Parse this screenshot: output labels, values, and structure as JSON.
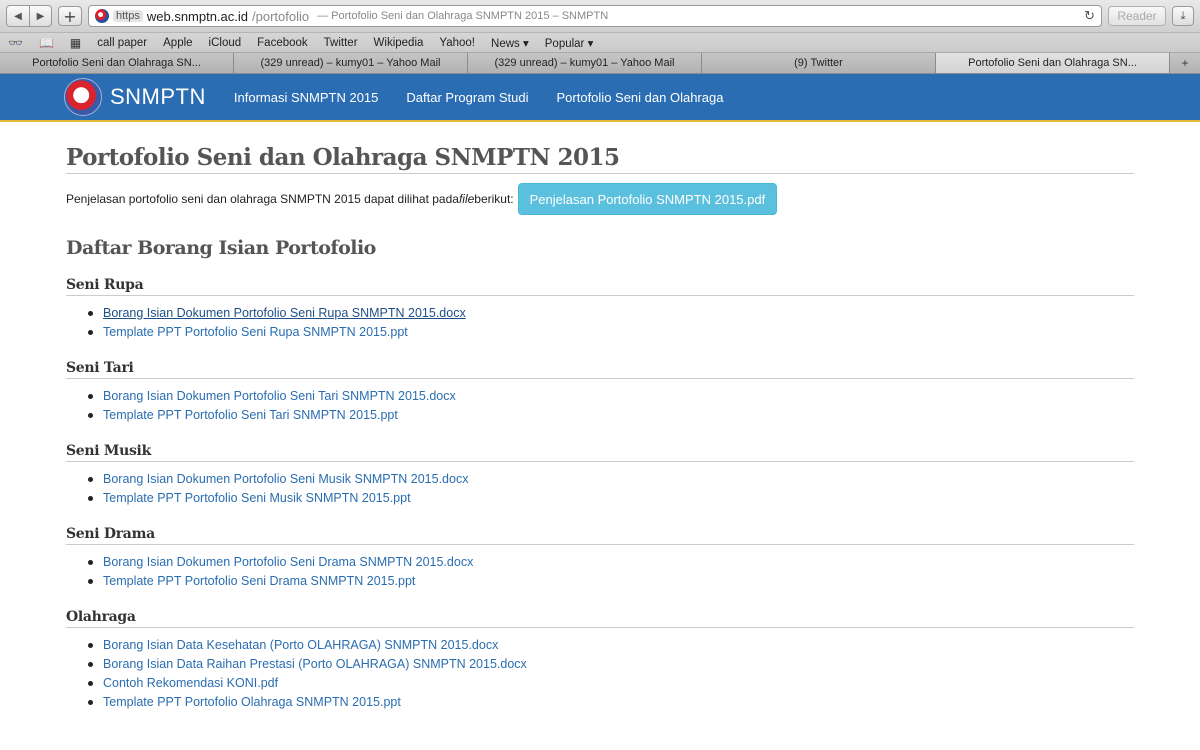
{
  "browser": {
    "address": {
      "https_label": "https",
      "host": "web.snmptn.ac.id",
      "path": "/portofolio",
      "page_title": "— Portofolio Seni dan Olahraga SNMPTN 2015 – SNMPTN",
      "reader_label": "Reader"
    },
    "bookmarks": [
      "call paper",
      "Apple",
      "iCloud",
      "Facebook",
      "Twitter",
      "Wikipedia",
      "Yahoo!",
      "News ▾",
      "Popular ▾"
    ],
    "tabs": [
      {
        "label": "Portofolio Seni dan Olahraga SN...",
        "active": false
      },
      {
        "label": "(329 unread) – kumy01 – Yahoo Mail",
        "active": false
      },
      {
        "label": "(329 unread) – kumy01 – Yahoo Mail",
        "active": false
      },
      {
        "label": "(9) Twitter",
        "active": false
      },
      {
        "label": "Portofolio Seni dan Olahraga SN...",
        "active": true
      }
    ]
  },
  "site": {
    "logo_text": "SNMPTN",
    "nav": [
      "Informasi SNMPTN 2015",
      "Daftar Program Studi",
      "Portofolio Seni dan Olahraga"
    ]
  },
  "page": {
    "title": "Portofolio Seni dan Olahraga SNMPTN 2015",
    "intro_before": "Penjelasan portofolio seni dan olahraga SNMPTN 2015 dapat dilihat pada ",
    "intro_em": "file",
    "intro_after": " berikut:",
    "pdf_button": "Penjelasan Portofolio SNMPTN 2015.pdf",
    "list_heading": "Daftar Borang Isian Portofolio",
    "sections": [
      {
        "heading": "Seni Rupa",
        "links": [
          "Borang Isian Dokumen Portofolio Seni Rupa SNMPTN 2015.docx",
          "Template PPT Portofolio Seni Rupa SNMPTN 2015.ppt"
        ]
      },
      {
        "heading": "Seni Tari",
        "links": [
          "Borang Isian Dokumen Portofolio Seni Tari SNMPTN 2015.docx",
          "Template PPT Portofolio Seni Tari SNMPTN 2015.ppt"
        ]
      },
      {
        "heading": "Seni Musik",
        "links": [
          "Borang Isian Dokumen Portofolio Seni Musik SNMPTN 2015.docx",
          "Template PPT Portofolio Seni Musik SNMPTN 2015.ppt"
        ]
      },
      {
        "heading": "Seni Drama",
        "links": [
          "Borang Isian Dokumen Portofolio Seni Drama SNMPTN 2015.docx",
          "Template PPT Portofolio Seni Drama SNMPTN 2015.ppt"
        ]
      },
      {
        "heading": "Olahraga",
        "links": [
          "Borang Isian Data Kesehatan (Porto OLAHRAGA) SNMPTN 2015.docx",
          "Borang Isian Data Raihan Prestasi (Porto OLAHRAGA) SNMPTN 2015.docx",
          "Contoh Rekomendasi KONI.pdf",
          "Template PPT Portofolio Olahraga SNMPTN 2015.ppt"
        ]
      }
    ]
  },
  "colors": {
    "navbar": "#2b6db3",
    "navbar_border": "#e8b73a",
    "link": "#2a6db0",
    "button": "#5bc0de"
  }
}
